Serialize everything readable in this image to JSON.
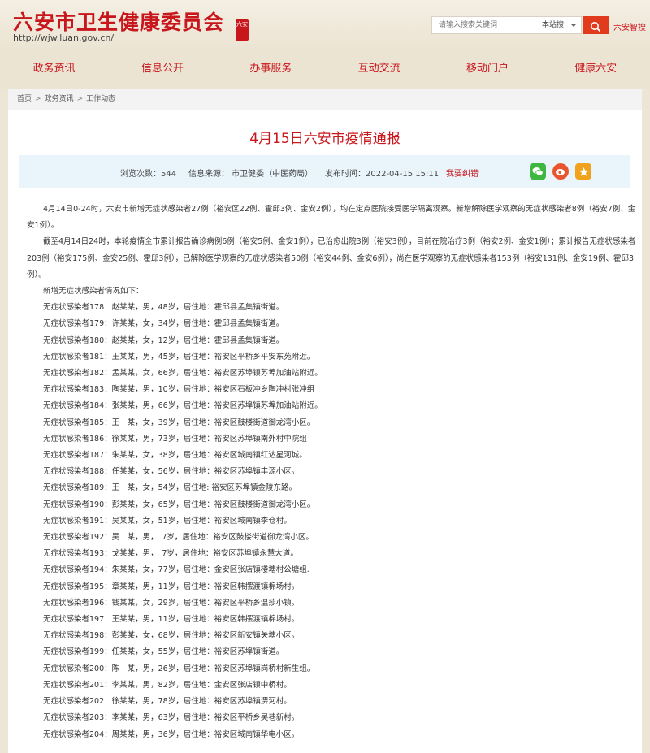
{
  "header": {
    "site_title": "六安市卫生健康委员会",
    "seal_text": "六安",
    "site_url": "http://wjw.luan.gov.cn/",
    "search_placeholder": "请输入搜索关键词",
    "search_scope": "本站搜",
    "smart_link": "六安智搜",
    "colors": {
      "brand_red": "#c8161d",
      "button_red": "#e23a1c",
      "background": "#ede6d6"
    },
    "icons": {
      "search": "search-icon",
      "scope": "chevron-down-icon"
    }
  },
  "nav": [
    "政务资讯",
    "信息公开",
    "办事服务",
    "互动交流",
    "移动门户",
    "健康六安"
  ],
  "breadcrumb": [
    "首页",
    "政务资讯",
    "工作动态"
  ],
  "article": {
    "title": "4月15日六安市疫情通报",
    "meta": {
      "views": "浏览次数：544",
      "source": "信息来源： 市卫健委（中医药局）",
      "time": "发布时间：2022-04-15 15:11",
      "correction": "我要纠错"
    },
    "share_icons": [
      "wechat-icon",
      "weibo-icon",
      "favorite-icon"
    ],
    "paragraphs": [
      "4月14日0-24时，六安市新增无症状感染者27例（裕安区22例、霍邱3例、金安2例），均在定点医院接受医学隔离观察。新增解除医学观察的无症状感染者8例（裕安7例、金安1例）。",
      "截至4月14日24时，本轮疫情全市累计报告确诊病例6例（裕安5例、金安1例），已治愈出院3例（裕安3例），目前在院治疗3例（裕安2例、金安1例）；累计报告无症状感染者203例（裕安175例、金安25例、霍邱3例），已解除医学观察的无症状感染者50例（裕安44例、金安6例），尚在医学观察的无症状感染者153例（裕安131例、金安19例、霍邱3例）。",
      "新增无症状感染者情况如下："
    ],
    "cases": [
      "无症状感染者178：赵某某，男，48岁，居住地：霍邱县孟集镇街道。",
      "无症状感染者179：许某某，女，34岁，居住地：霍邱县孟集镇街道。",
      "无症状感染者180：赵某某，女，12岁，居住地：霍邱县孟集镇街道。",
      "无症状感染者181：王某某，男，45岁，居住地：裕安区平桥乡平安东苑附近。",
      "无症状感染者182：孟某某，女，66岁，居住地：裕安区苏埠镇苏埠加油站附近。",
      "无症状感染者183：陶某某，男，10岁，居住地：裕安区石板冲乡陶冲村张冲组",
      "无症状感染者184：张某某，男，66岁，居住地：裕安区苏埠镇苏埠加油站附近。",
      "无症状感染者185：王　某，女，39岁，居住地：裕安区鼓楼街道御龙湾小区。",
      "无症状感染者186：徐某某，男，73岁，居住地：裕安区苏埠镇南外村中院组",
      "无症状感染者187：朱某某，女，38岁，居住地：裕安区城南镇红达星河城。",
      "无症状感染者188：任某某，女，56岁，居住地：裕安区苏埠镇丰源小区。",
      "无症状感染者189：王　某，女，54岁，居住地: 裕安区苏埠镇金陵东路。",
      "无症状感染者190：彭某某，女，65岁，居住地：裕安区鼓楼街道御龙湾小区。",
      "无症状感染者191：吴某某，女，51岁，居住地：裕安区城南镇李仓村。",
      "无症状感染者192：吴　某，男，　7岁，居住地：裕安区鼓楼街道御龙湾小区。",
      "无症状感染者193：戈某某，男，　7岁，居住地：裕安区苏埠镇永慧大道。",
      "无症状感染者194：朱某某，女，77岁，居住地：金安区张店镇楼塘村公塘组.",
      "无症状感染者195：章某某，男，11岁，居住地：裕安区韩摆渡镇棉场村。",
      "无症状感染者196：钱某某，女，29岁，居住地：裕安区平桥乡温莎小镇。",
      "无症状感染者197：王某某，男，11岁，居住地：裕安区韩摆渡镇棉场村。",
      "无症状感染者198：彭某某，女，68岁，居住地：裕安区新安镇关塘小区。",
      "无症状感染者199：任某某，女，55岁，居住地：裕安区苏埠镇街道。",
      "无症状感染者200：陈　某，男，26岁，居住地：裕安区苏埠镇岗桥村新生组。",
      "无症状感染者201：李某某，男，82岁，居住地：金安区张店镇中桥村。",
      "无症状感染者202：徐某某，男，78岁，居住地：裕安区苏埠镇淠河村。",
      "无症状感染者203：李某某，男，63岁，居住地：裕安区平桥乡吴巷新村。",
      "无症状感染者204：周某某，男，36岁，居住地：裕安区城南镇华电小区。"
    ]
  }
}
